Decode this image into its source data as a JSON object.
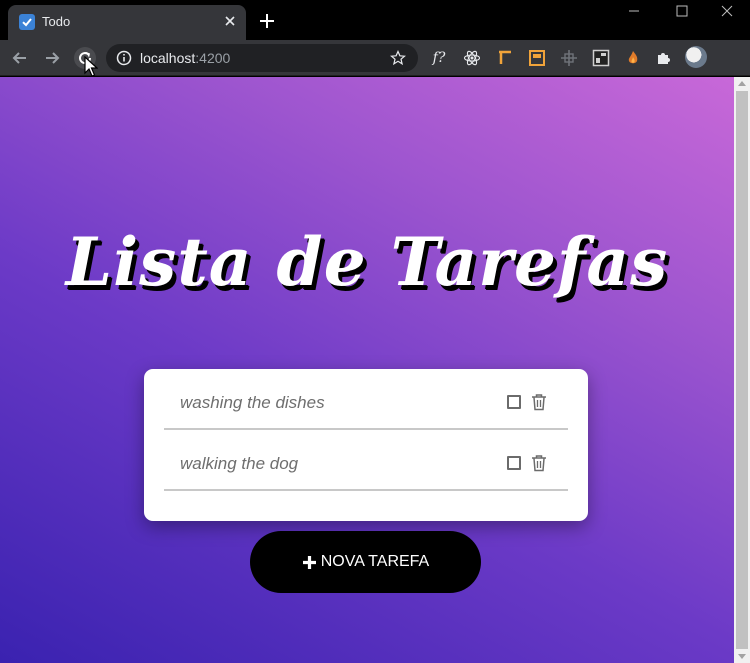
{
  "browser": {
    "tab_title": "Todo",
    "url_host": "localhost",
    "url_port": ":4200",
    "extensions": [
      "function-icon",
      "react-icon",
      "ruler-icon",
      "box-icon",
      "move-icon",
      "terminal-icon",
      "fire-icon",
      "puzzle-icon"
    ],
    "ext_func_label": "f?"
  },
  "page": {
    "title": "Lista de Tarefas",
    "tasks": [
      {
        "text": "washing the dishes",
        "done": false
      },
      {
        "text": "walking the dog",
        "done": false
      }
    ],
    "add_button_label": "NOVA TAREFA"
  },
  "colors": {
    "gradient_start": "#3a22b0",
    "gradient_end": "#c868d8",
    "card_bg": "#ffffff",
    "button_bg": "#000000"
  }
}
